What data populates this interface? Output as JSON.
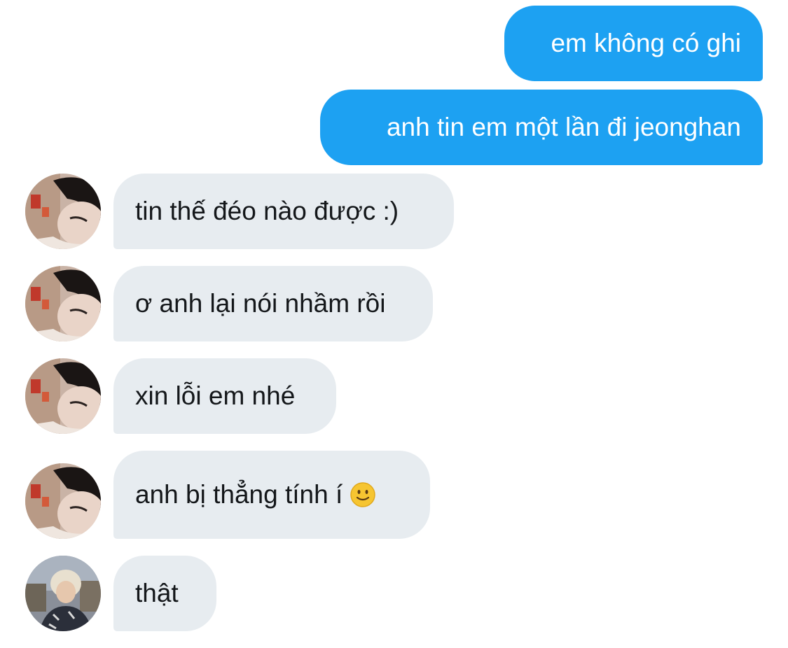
{
  "messages": [
    {
      "direction": "outgoing",
      "text": "em không có ghi"
    },
    {
      "direction": "outgoing",
      "text": "anh tin em một lần đi jeonghan"
    },
    {
      "direction": "incoming",
      "avatar": "avatar-user-a",
      "text": "tin thế đéo nào được :)"
    },
    {
      "direction": "incoming",
      "avatar": "avatar-user-a",
      "text": "ơ anh lại nói nhầm rồi"
    },
    {
      "direction": "incoming",
      "avatar": "avatar-user-a",
      "text": "xin lỗi em nhé"
    },
    {
      "direction": "incoming",
      "avatar": "avatar-user-a",
      "text": "anh bị thẳng tính í",
      "emoji": "slightly-smiling-face-icon"
    },
    {
      "direction": "incoming",
      "avatar": "avatar-user-b",
      "text": "thật"
    }
  ],
  "colors": {
    "outgoing_bubble": "#1da1f2",
    "incoming_bubble": "#e7ecf0",
    "incoming_text": "#14171a",
    "outgoing_text": "#ffffff"
  }
}
